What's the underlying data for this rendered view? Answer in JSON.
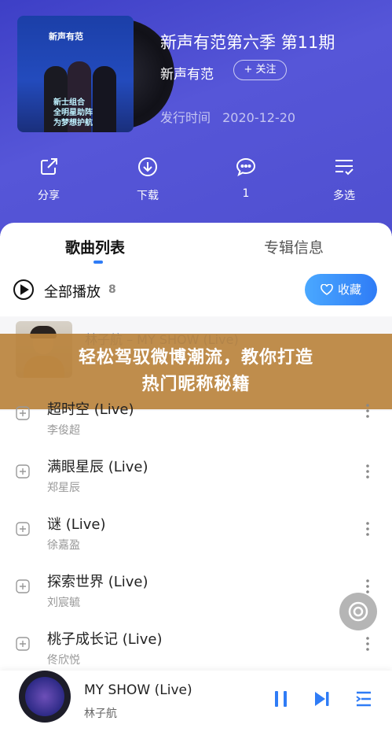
{
  "album": {
    "cover_logo": "新声有范",
    "cover_tag_line1": "新士组合",
    "cover_tag_line2": "全明星助阵",
    "cover_tag_line3": "为梦想护航",
    "title": "新声有范第六季 第11期",
    "artist": "新声有范",
    "follow_label": "+ 关注",
    "release_label": "发行时间",
    "release_date": "2020-12-20"
  },
  "actions": [
    {
      "label": "分享",
      "icon": "share-icon"
    },
    {
      "label": "下载",
      "icon": "download-icon"
    },
    {
      "label": "1",
      "icon": "comment-icon"
    },
    {
      "label": "多选",
      "icon": "multi-select-icon"
    }
  ],
  "tabs": {
    "songs": "歌曲列表",
    "album_info": "专辑信息"
  },
  "play_all": {
    "label": "全部播放",
    "count": "8"
  },
  "collect_label": "收藏",
  "first_song": {
    "title": "林子航 – MY SHOW (Live)"
  },
  "banner": {
    "line1": "轻松驾驭微博潮流，教你打造",
    "line2": "热门昵称秘籍"
  },
  "songs": [
    {
      "title": "超时空 (Live)",
      "artist": "李俊超"
    },
    {
      "title": "满眼星辰 (Live)",
      "artist": "郑星辰"
    },
    {
      "title": "谜 (Live)",
      "artist": "徐嘉盈"
    },
    {
      "title": "探索世界 (Live)",
      "artist": "刘宸毓"
    },
    {
      "title": "桃子成长记 (Live)",
      "artist": "佟欣悦"
    }
  ],
  "player": {
    "title": "MY SHOW (Live)",
    "artist": "林子航"
  },
  "colors": {
    "hero_bg": "#4f4fd0",
    "accent": "#2f7cf6",
    "banner": "#ba843e"
  }
}
